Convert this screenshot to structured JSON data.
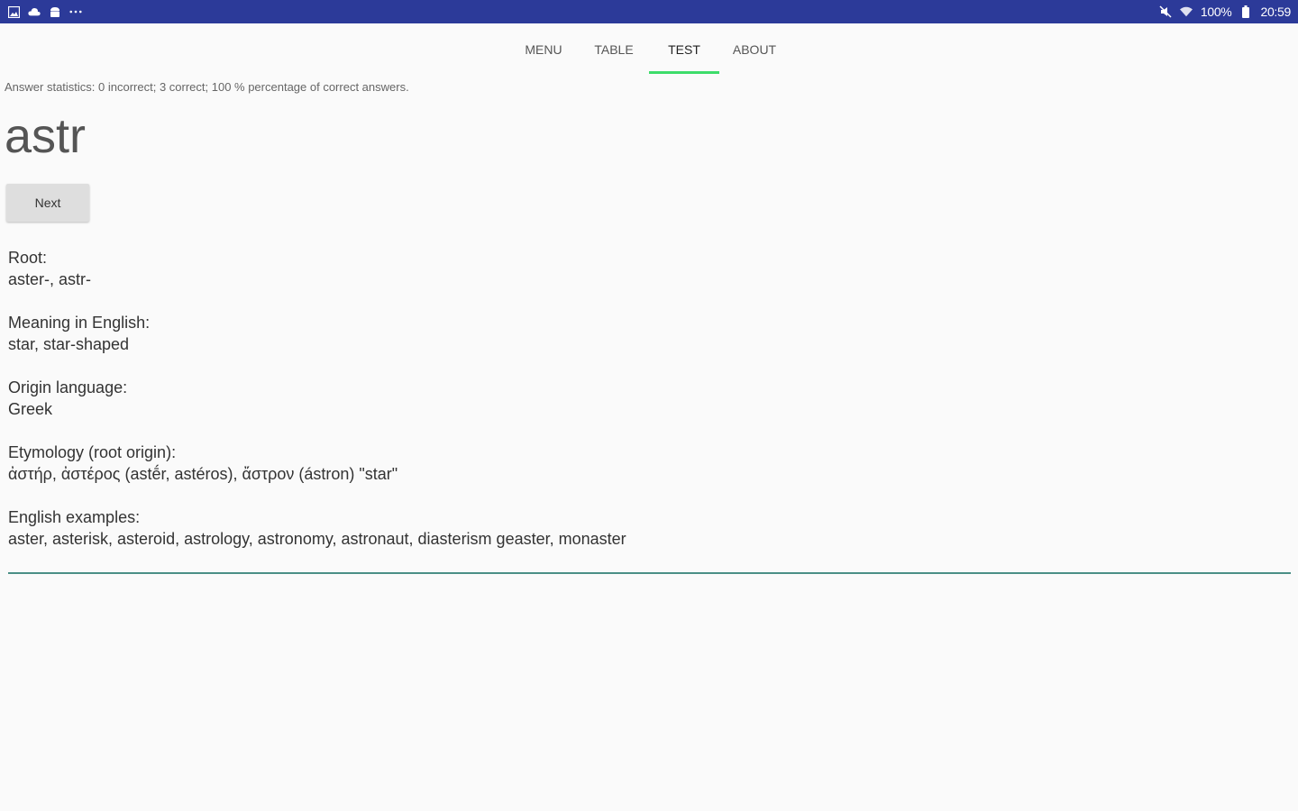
{
  "status_bar": {
    "icons_left": [
      "gallery-icon",
      "cloud-icon",
      "android-icon",
      "more-icon"
    ],
    "battery": "100%",
    "time": "20:59"
  },
  "tabs": [
    {
      "label": "MENU",
      "active": false
    },
    {
      "label": "TABLE",
      "active": false
    },
    {
      "label": "TEST",
      "active": true
    },
    {
      "label": "ABOUT",
      "active": false
    }
  ],
  "stats": {
    "text": "Answer statistics: 0 incorrect; 3 correct; 100 % percentage of correct answers."
  },
  "question": {
    "root_word": "astr",
    "next_label": "Next"
  },
  "info": {
    "root_label": "Root:",
    "root_value": "aster-, astr-",
    "meaning_label": "Meaning in English:",
    "meaning_value": "star, star-shaped",
    "origin_label": "Origin language:",
    "origin_value": "Greek",
    "etymology_label": "Etymology (root origin):",
    "etymology_value": "ἀστήρ, ἀστέρος (astḗr, astéros), ἄστρον (ástron) \"star\"",
    "examples_label": "English examples:",
    "examples_value": "aster, asterisk, asteroid, astrology, astronomy, astronaut, diasterism geaster, monaster"
  },
  "answer_input": {
    "value": ""
  },
  "colors": {
    "status_bar": "#2c3a99",
    "tab_indicator": "#3ddc6a",
    "input_underline": "#4a8f86",
    "background": "#fafafa"
  }
}
